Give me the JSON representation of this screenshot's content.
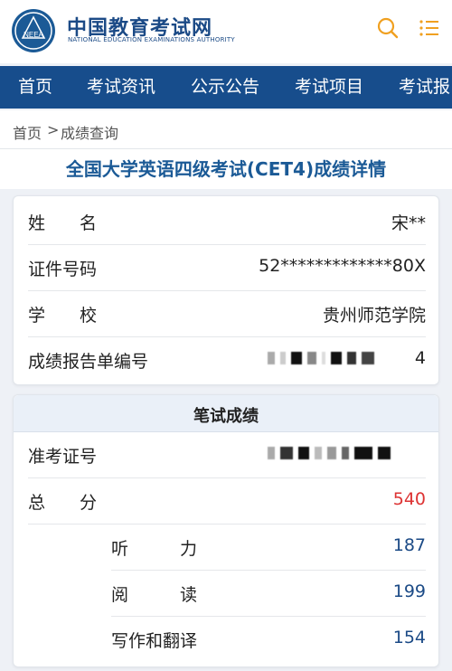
{
  "header": {
    "logo_text": "NEEA",
    "site_title": "中国教育考试网",
    "site_subtitle": "NATIONAL EDUCATION EXAMINATIONS AUTHORITY",
    "accent": "#f0a020"
  },
  "nav": {
    "items": [
      {
        "label": "首页"
      },
      {
        "label": "考试资讯"
      },
      {
        "label": "公示公告"
      },
      {
        "label": "考试项目"
      },
      {
        "label": "考试报"
      }
    ]
  },
  "breadcrumb": {
    "home": "首页",
    "separator": ">",
    "current": "成绩查询"
  },
  "page_title": "全国大学英语四级考试(CET4)成绩详情",
  "info": {
    "name_label": "姓　　名",
    "name_value": "宋**",
    "id_label": "证件号码",
    "id_value": "52*************80X",
    "school_label": "学　　校",
    "school_value": "贵州师范学院",
    "report_label": "成绩报告单编号",
    "report_value_tail": "4"
  },
  "written": {
    "section_title": "笔试成绩",
    "ticket_label": "准考证号",
    "total_label": "总　　分",
    "total_value": "540",
    "listening_label": "听　　　力",
    "listening_value": "187",
    "reading_label": "阅　　　读",
    "reading_value": "199",
    "writing_label": "写作和翻译",
    "writing_value": "154"
  }
}
